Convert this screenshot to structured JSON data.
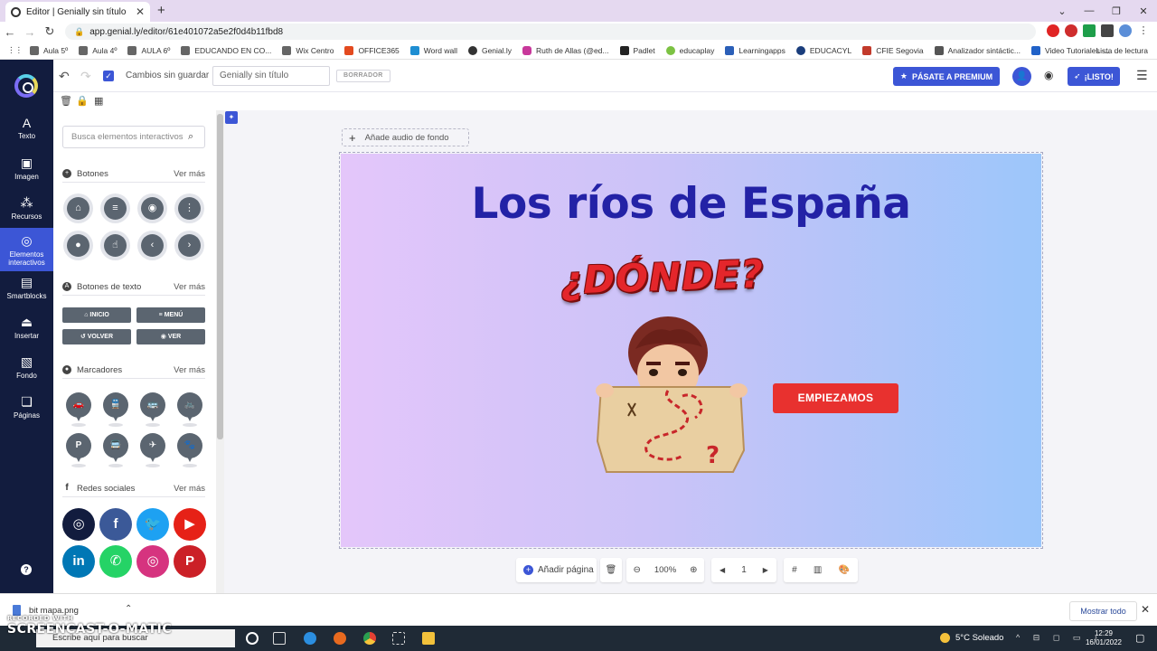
{
  "browser": {
    "tab_title": "Editor | Genially sin título",
    "url": "app.genial.ly/editor/61e401072a5e2f0d4b11fbd8",
    "bookmarks": [
      "Aula 5º",
      "Aula 4º",
      "AULA 6º",
      "EDUCANDO EN CO...",
      "Wix Centro",
      "OFFICE365",
      "Word wall",
      "Genial.ly",
      "Ruth de Allas (@ed...",
      "Padlet",
      "educaplay",
      "Learningapps",
      "EDUCACYL",
      "CFIE Segovia",
      "Analizador sintáctic...",
      "Video Tutoriales -..."
    ],
    "reading_list": "Lista de lectura"
  },
  "sidebar": {
    "items": [
      {
        "label": "Texto",
        "icon": "text-icon"
      },
      {
        "label": "Imagen",
        "icon": "image-icon"
      },
      {
        "label": "Recursos",
        "icon": "resources-icon"
      },
      {
        "label": "Elementos interactivos",
        "icon": "interactive-icon"
      },
      {
        "label": "Smartblocks",
        "icon": "smartblocks-icon"
      },
      {
        "label": "Insertar",
        "icon": "insert-icon"
      },
      {
        "label": "Fondo",
        "icon": "background-icon"
      },
      {
        "label": "Páginas",
        "icon": "pages-icon"
      }
    ]
  },
  "toolbar": {
    "status": "Cambios sin guardar",
    "title_value": "Genially sin título",
    "draft_label": "BORRADOR",
    "premium_label": "PÁSATE A PREMIUM",
    "ready_label": "¡LISTO!"
  },
  "panel": {
    "search_placeholder": "Busca elementos interactivos",
    "see_more": "Ver más",
    "sections": {
      "buttons": "Botones",
      "text_buttons": "Botones de texto",
      "markers": "Marcadores",
      "social": "Redes sociales"
    },
    "text_buttons": [
      "INICIO",
      "MENÚ",
      "VOLVER",
      "VER"
    ]
  },
  "canvas": {
    "audio_label": "Añade audio de fondo",
    "title": "Los ríos de España",
    "donde": "¿DÓNDE?",
    "start_button": "EMPIEZAMOS",
    "colors": {
      "title": "#2322a6",
      "button": "#e8312f",
      "accent": "#3c56d6"
    }
  },
  "bottom": {
    "add_page": "Añadir página",
    "zoom": "100%",
    "page": "1"
  },
  "downloads": {
    "file": "bit mapa.png",
    "show_all": "Mostrar todo"
  },
  "taskbar": {
    "search_placeholder": "Escribe aquí para buscar",
    "weather": "5°C Soleado",
    "time": "12:29",
    "date": "16/01/2022"
  },
  "watermark": {
    "line1": "RECORDED WITH",
    "line2": "SCREENCAST-O-MATIC"
  }
}
